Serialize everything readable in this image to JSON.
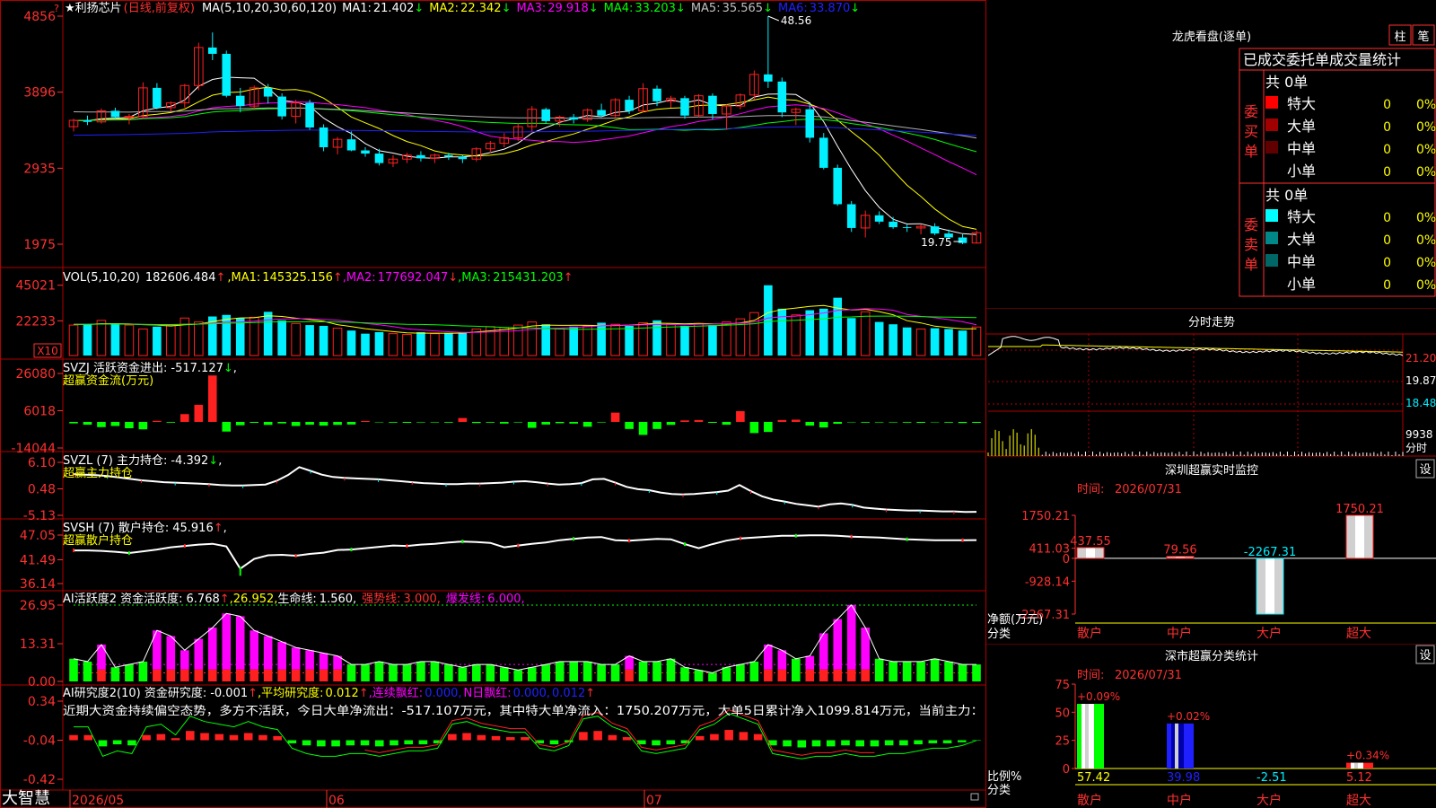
{
  "colors": {
    "up": "#ff2020",
    "down": "#00f0ff",
    "frame": "#b00000",
    "yellow": "#ffff00",
    "magenta": "#ff00ff",
    "green": "#00ff00",
    "white": "#ffffff",
    "blue": "#2020ff",
    "gray": "#b0b0b0",
    "label": "#ff3030"
  },
  "main": {
    "star": "★",
    "title": "利扬芯片",
    "mode": "(日线,前复权)",
    "ma_spec": "MA(5,10,20,30,60,120)",
    "ma": [
      {
        "k": "MA1:",
        "v": "21.402",
        "a": "↓",
        "c": "#ffffff"
      },
      {
        "k": "MA2:",
        "v": "22.342",
        "a": "↓",
        "c": "#ffff00"
      },
      {
        "k": "MA3:",
        "v": "29.918",
        "a": "↓",
        "c": "#ff00ff"
      },
      {
        "k": "MA4:",
        "v": "33.203",
        "a": "↓",
        "c": "#00ff00"
      },
      {
        "k": "MA5:",
        "v": "35.565",
        "a": "↓",
        "c": "#c0c0c0"
      },
      {
        "k": "MA6:",
        "v": "33.870",
        "a": "↓",
        "c": "#2020ff"
      }
    ],
    "yticks": [
      "4856",
      "3896",
      "2935",
      "1975"
    ],
    "y_corner": "?",
    "high_label": "48.56",
    "low_label": "19.75"
  },
  "vol": {
    "label": "VOL(5,10,20)",
    "v": "182606.484",
    "a": "↑",
    "ma": [
      {
        "k": "MA1:",
        "v": "145325.156",
        "a": "↑",
        "c": "#ffff00"
      },
      {
        "k": "MA2:",
        "v": "177692.047",
        "a": "↓",
        "c": "#ff00ff"
      },
      {
        "k": "MA3:",
        "v": "215431.203",
        "a": "↑",
        "c": "#00ff00"
      }
    ],
    "yticks": [
      "45021",
      "22233"
    ],
    "unit": "X10"
  },
  "svzj": {
    "label": "SVZJ 活跃资金进出:",
    "v": "-517.127",
    "a": "↓",
    "tail": ",",
    "sub": "超赢资金流(万元)",
    "yticks": [
      "26080",
      "6018",
      "-14044"
    ]
  },
  "svzl": {
    "label": "SVZL (7) 主力持仓:",
    "v": "-4.392",
    "a": "↓",
    "tail": ",",
    "sub": "超赢主力持仓",
    "yticks": [
      "6.10",
      "0.48",
      "-5.13"
    ]
  },
  "svsh": {
    "label": "SVSH (7) 散户持仓:",
    "v": "45.916",
    "a": "↑",
    "tail": ",",
    "sub": "超赢散户持仓",
    "yticks": [
      "47.05",
      "41.49",
      "36.14"
    ]
  },
  "ai1": {
    "label": "AI活跃度2 资金活跃度:",
    "v": "6.768",
    "a": "↑",
    "v2": ",26.952,",
    "k3": "生命线:",
    "v3": "1.560,",
    "k4": "强势线:",
    "v4": "3.000,",
    "k5": "爆发线:",
    "v5": "6.000,",
    "yticks": [
      "26.95",
      "13.31",
      "0.00"
    ]
  },
  "ai2": {
    "label": "AI研究度2(10) 资金研究度:",
    "v": "-0.001",
    "a": "↑",
    "k2": ",平均研究度:",
    "v2": "0.012",
    "a2": "↑",
    "k3": ",连续飘红:",
    "v3": "0.000,",
    "k4": "N日飘红:",
    "v4": "0.000,",
    "v5": "0.012",
    "a5": "↑",
    "comment": "近期大资金持续偏空态势，多方不活跃，今日大单净流出：-517.107万元，其中特大单净流入：1750.207万元，大单5日累计净入1099.814万元，当前主力：",
    "yticks": [
      "0.34",
      "-0.04",
      "-0.42"
    ]
  },
  "xaxis": {
    "brand": "大智慧",
    "labels": [
      "2026/05",
      "06",
      "07"
    ]
  },
  "lhb": {
    "title": "龙虎看盘(逐单)",
    "btn1": "柱",
    "btn2": "笔",
    "tabs": "已成交委托单成交量统计",
    "buy": {
      "side": "委买单",
      "count": "共 0单",
      "rows": [
        [
          "特大",
          "0",
          "0%",
          "#ff0000"
        ],
        [
          "大单",
          "0",
          "0%",
          "#a00000"
        ],
        [
          "中单",
          "0",
          "0%",
          "#600000"
        ],
        [
          "小单",
          "0",
          "0%",
          ""
        ]
      ]
    },
    "sell": {
      "side": "委卖单",
      "count": "共 0单",
      "rows": [
        [
          "特大",
          "0",
          "0%",
          "#00ffff"
        ],
        [
          "大单",
          "0",
          "0%",
          "#008888"
        ],
        [
          "中单",
          "0",
          "0%",
          "#006666"
        ],
        [
          "小单",
          "0",
          "0%",
          ""
        ]
      ]
    }
  },
  "fenshi": {
    "title": "分时走势",
    "yticks": [
      "21.20",
      "19.87",
      "18.48"
    ],
    "vol_tick": "9938",
    "unit": "分时"
  },
  "sz_monitor": {
    "title": "深圳超赢实时监控",
    "btn": "设",
    "time_k": "时间:",
    "time": "2026/07/31",
    "yticks": [
      "1750.21",
      "411.03",
      "0",
      "-928.14",
      "-2267.31"
    ],
    "ylabel": "净额(万元)",
    "xlabel": "分类",
    "bars": [
      {
        "cat": "散户",
        "v": 437.55,
        "l": "437.55"
      },
      {
        "cat": "中户",
        "v": 79.56,
        "l": "79.56"
      },
      {
        "cat": "大户",
        "v": -2267.31,
        "l": "-2267.31"
      },
      {
        "cat": "超大",
        "v": 1750.21,
        "l": "1750.21"
      }
    ]
  },
  "sz_class": {
    "title": "深市超赢分类统计",
    "btn": "设",
    "time_k": "时间:",
    "time": "2026/07/31",
    "yticks": [
      "75",
      "50",
      "25",
      "0"
    ],
    "ylabel": "比例%",
    "xlabel": "分类",
    "bars": [
      {
        "cat": "散户",
        "v": 57.42,
        "l": "57.42",
        "chg": "+0.09%"
      },
      {
        "cat": "中户",
        "v": 39.98,
        "l": "39.98",
        "chg": "+0.02%"
      },
      {
        "cat": "大户",
        "v": -2.51,
        "l": "-2.51",
        "chg": ""
      },
      {
        "cat": "超大",
        "v": 5.12,
        "l": "5.12",
        "chg": "+0.34%"
      }
    ]
  },
  "chart_data": [
    {
      "type": "candlestick",
      "title": "利扬芯片",
      "ylim": [
        19.75,
        48.56
      ],
      "ohlc": [
        [
          34.6,
          35.6,
          34.0,
          35.4
        ],
        [
          35.4,
          36.0,
          34.8,
          35.2
        ],
        [
          35.2,
          36.9,
          35.0,
          36.6
        ],
        [
          36.6,
          37.0,
          35.6,
          35.8
        ],
        [
          35.8,
          36.2,
          34.9,
          35.9
        ],
        [
          35.9,
          40.2,
          35.6,
          39.5
        ],
        [
          39.5,
          40.1,
          36.8,
          37.0
        ],
        [
          37.0,
          37.8,
          36.5,
          37.6
        ],
        [
          37.6,
          40.0,
          37.0,
          39.8
        ],
        [
          39.8,
          45.2,
          39.2,
          44.6
        ],
        [
          44.6,
          46.5,
          43.0,
          43.8
        ],
        [
          43.8,
          44.2,
          38.3,
          38.5
        ],
        [
          38.5,
          39.5,
          36.4,
          37.2
        ],
        [
          37.2,
          39.8,
          36.8,
          39.5
        ],
        [
          39.5,
          40.0,
          37.5,
          38.4
        ],
        [
          38.4,
          38.8,
          35.5,
          35.9
        ],
        [
          35.9,
          38.0,
          35.0,
          37.6
        ],
        [
          37.6,
          38.0,
          34.2,
          34.5
        ],
        [
          34.5,
          34.9,
          31.5,
          32.0
        ],
        [
          32.0,
          33.3,
          31.1,
          33.0
        ],
        [
          33.0,
          34.0,
          31.5,
          31.6
        ],
        [
          31.6,
          32.0,
          30.8,
          31.2
        ],
        [
          31.2,
          31.8,
          29.7,
          30.0
        ],
        [
          30.0,
          31.0,
          29.5,
          30.5
        ],
        [
          30.5,
          31.3,
          30.0,
          31.0
        ],
        [
          31.0,
          31.5,
          30.2,
          30.6
        ],
        [
          30.6,
          31.2,
          30.0,
          31.0
        ],
        [
          31.0,
          31.3,
          30.4,
          30.8
        ],
        [
          30.8,
          31.0,
          30.0,
          30.5
        ],
        [
          30.5,
          32.0,
          30.2,
          31.8
        ],
        [
          31.8,
          32.8,
          31.3,
          32.5
        ],
        [
          32.5,
          33.8,
          32.0,
          33.2
        ],
        [
          33.2,
          35.0,
          32.8,
          34.6
        ],
        [
          34.6,
          37.2,
          34.0,
          36.8
        ],
        [
          36.8,
          37.0,
          35.0,
          35.3
        ],
        [
          35.3,
          36.0,
          34.6,
          35.8
        ],
        [
          35.8,
          36.2,
          35.0,
          35.5
        ],
        [
          35.5,
          36.9,
          35.2,
          36.7
        ],
        [
          36.7,
          37.5,
          35.8,
          36.0
        ],
        [
          36.0,
          38.2,
          35.8,
          38.0
        ],
        [
          38.0,
          38.5,
          36.2,
          36.6
        ],
        [
          36.6,
          40.1,
          36.4,
          39.4
        ],
        [
          39.4,
          39.8,
          37.2,
          37.8
        ],
        [
          37.8,
          38.5,
          37.0,
          38.2
        ],
        [
          38.2,
          38.5,
          35.6,
          36.0
        ],
        [
          36.0,
          38.7,
          35.8,
          38.5
        ],
        [
          38.5,
          38.8,
          35.5,
          36.2
        ],
        [
          36.2,
          37.4,
          34.2,
          37.2
        ],
        [
          37.2,
          38.8,
          36.8,
          38.6
        ],
        [
          38.6,
          41.7,
          38.0,
          41.2
        ],
        [
          41.2,
          48.56,
          39.5,
          40.3
        ],
        [
          40.3,
          40.8,
          35.8,
          36.4
        ],
        [
          36.4,
          37.0,
          34.8,
          36.8
        ],
        [
          36.8,
          37.5,
          32.6,
          33.2
        ],
        [
          33.2,
          33.8,
          29.2,
          29.4
        ],
        [
          29.4,
          29.8,
          24.6,
          24.8
        ],
        [
          24.8,
          25.2,
          21.3,
          21.8
        ],
        [
          21.8,
          24.0,
          20.6,
          23.4
        ],
        [
          23.4,
          23.9,
          22.3,
          22.6
        ],
        [
          22.6,
          23.2,
          21.7,
          21.9
        ],
        [
          21.9,
          22.2,
          21.3,
          21.8
        ],
        [
          21.8,
          22.3,
          21.0,
          22.0
        ],
        [
          22.0,
          22.4,
          20.9,
          21.1
        ],
        [
          21.1,
          21.6,
          20.4,
          20.6
        ],
        [
          20.6,
          21.0,
          19.75,
          19.9
        ],
        [
          19.9,
          21.5,
          19.8,
          21.2
        ]
      ],
      "ma_series": [
        {
          "name": "MA1",
          "value": "21.402",
          "color": "#ffffff"
        },
        {
          "name": "MA2",
          "value": "22.342",
          "color": "#ffff00"
        },
        {
          "name": "MA3",
          "value": "29.918",
          "color": "#ff00ff"
        },
        {
          "name": "MA4",
          "value": "33.203",
          "color": "#00ff00"
        },
        {
          "name": "MA5",
          "value": "35.565",
          "color": "#c0c0c0"
        },
        {
          "name": "MA6",
          "value": "33.870",
          "color": "#2020ff"
        }
      ]
    },
    {
      "type": "bar",
      "title": "VOL",
      "values": [
        195,
        200,
        225,
        200,
        195,
        170,
        185,
        195,
        240,
        215,
        250,
        260,
        240,
        245,
        280,
        225,
        205,
        195,
        190,
        175,
        160,
        140,
        150,
        140,
        135,
        150,
        140,
        145,
        150,
        170,
        185,
        180,
        195,
        215,
        200,
        175,
        185,
        190,
        210,
        200,
        190,
        210,
        225,
        200,
        190,
        205,
        195,
        215,
        235,
        275,
        450,
        300,
        260,
        290,
        300,
        370,
        240,
        280,
        215,
        200,
        180,
        170,
        175,
        170,
        160,
        182.6
      ]
    },
    {
      "type": "bar",
      "title": "SVZJ",
      "values": [
        -800,
        -1500,
        -2800,
        -2200,
        -3400,
        -4000,
        600,
        -400,
        4200,
        9200,
        25000,
        -5200,
        -1800,
        -500,
        -1600,
        -800,
        -2200,
        -1500,
        -2000,
        -1600,
        -1400,
        500,
        -200,
        -400,
        -500,
        -300,
        -300,
        -400,
        2100,
        -600,
        -400,
        -900,
        -300,
        -3200,
        -1400,
        -700,
        -900,
        -2600,
        -300,
        5000,
        -3800,
        -7000,
        -3800,
        -1600,
        800,
        1000,
        -500,
        -1500,
        5800,
        -6000,
        -5400,
        1000,
        1200,
        -2000,
        -3000,
        -1000,
        -200,
        -400,
        -300,
        -300,
        -400,
        -500,
        -200,
        -400,
        -600,
        -517
      ]
    },
    {
      "type": "line",
      "title": "SVZL",
      "values": [
        3.6,
        3.5,
        3.4,
        3.2,
        2.9,
        2.6,
        2.3,
        2.1,
        1.9,
        1.8,
        1.7,
        1.6,
        1.5,
        1.3,
        1.2,
        1.2,
        1.3,
        1.4,
        2.2,
        3.4,
        5.1,
        4.3,
        3.5,
        3.0,
        2.8,
        2.7,
        2.6,
        2.5,
        2.3,
        2.1,
        1.9,
        1.7,
        1.6,
        1.5,
        1.5,
        1.6,
        1.6,
        1.7,
        1.8,
        2.0,
        2.1,
        1.9,
        1.6,
        1.4,
        1.5,
        1.7,
        2.5,
        2.6,
        1.8,
        0.9,
        0.4,
        0.2,
        -0.3,
        -0.6,
        -0.7,
        -0.6,
        -0.4,
        -0.2,
        0.1,
        1.3,
        0.0,
        -1.1,
        -1.8,
        -2.2,
        -2.7,
        -3.0,
        -3.3,
        -2.8,
        -2.6,
        -2.9,
        -3.5,
        -3.7,
        -3.9,
        -4.0,
        -4.1,
        -4.1,
        -4.2,
        -4.3,
        -4.3,
        -4.4,
        -4.392
      ]
    },
    {
      "type": "line",
      "title": "SVSH",
      "values": [
        43.6,
        43.6,
        43.5,
        43.3,
        43.0,
        43.4,
        43.8,
        44.3,
        44.6,
        44.9,
        45.1,
        44.5,
        39.5,
        41.7,
        42.5,
        42.6,
        42.4,
        42.8,
        43.1,
        43.7,
        43.8,
        44.1,
        44.4,
        44.7,
        44.6,
        44.9,
        45.1,
        45.4,
        45.6,
        45.5,
        45.3,
        44.3,
        44.7,
        45.1,
        45.4,
        45.9,
        46.2,
        46.5,
        46.6,
        45.9,
        45.8,
        46.0,
        46.2,
        46.1,
        45.0,
        44.1,
        45.0,
        45.8,
        46.3,
        46.5,
        46.7,
        46.9,
        46.9,
        47.0,
        47.0,
        46.9,
        46.7,
        46.6,
        46.5,
        46.3,
        46.1,
        46.0,
        45.9,
        45.9,
        45.9,
        45.916
      ]
    },
    {
      "type": "bar",
      "title": "AI活跃度2",
      "values": [
        8,
        7,
        13,
        5,
        6,
        7,
        18,
        16,
        11,
        15,
        19,
        24,
        23,
        18,
        16,
        14,
        12,
        11,
        10,
        9,
        6,
        6,
        7,
        6,
        6,
        7,
        7,
        6,
        5,
        6,
        6,
        5,
        4,
        5,
        6,
        7,
        7,
        7,
        6,
        6,
        9,
        7,
        7,
        8,
        5,
        4,
        3,
        5,
        6,
        7,
        13,
        11,
        8,
        9,
        17,
        22,
        27,
        19,
        8,
        7,
        7,
        7,
        8,
        7,
        6,
        6
      ]
    },
    {
      "type": "bar",
      "title": "AI研究度2",
      "values": [
        0.05,
        0.05,
        -0.06,
        -0.04,
        -0.05,
        0.05,
        0.06,
        0.02,
        0.09,
        0.07,
        0.06,
        0.05,
        0.07,
        0.05,
        0.04,
        -0.03,
        -0.05,
        -0.06,
        -0.06,
        -0.05,
        -0.05,
        -0.06,
        -0.05,
        -0.04,
        -0.04,
        -0.03,
        0.06,
        0.07,
        0.05,
        0.04,
        0.03,
        0.03,
        -0.03,
        -0.04,
        -0.02,
        0.08,
        0.09,
        0.05,
        0.03,
        -0.04,
        -0.05,
        -0.04,
        -0.03,
        0.04,
        0.06,
        0.1,
        0.08,
        0.06,
        -0.05,
        -0.06,
        -0.07,
        -0.06,
        -0.06,
        -0.05,
        -0.06,
        -0.06,
        -0.05,
        -0.05,
        -0.04,
        -0.03,
        -0.03,
        -0.02,
        -0.001
      ]
    }
  ]
}
